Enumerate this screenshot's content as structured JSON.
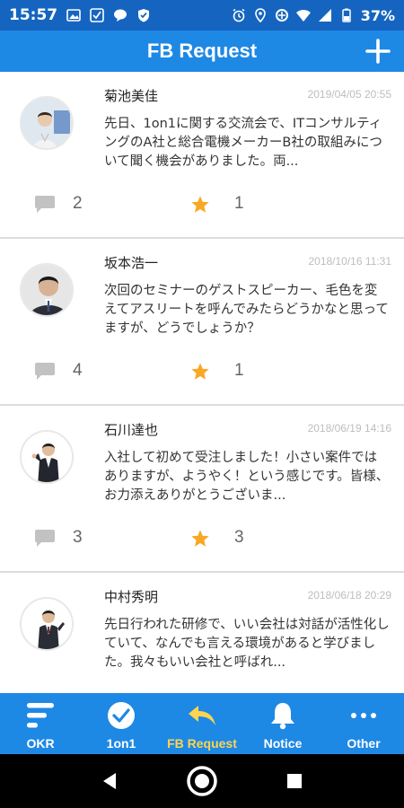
{
  "status_bar": {
    "time": "15:57",
    "battery": "37%"
  },
  "app_bar": {
    "title": "FB Request"
  },
  "colors": {
    "primary": "#1e88e5",
    "status": "#1565c0",
    "star": "#f9a825",
    "active_tab": "#ffd54f"
  },
  "feed": {
    "items": [
      {
        "name": "菊池美佳",
        "date": "2019/04/05 20:55",
        "text": "先日、1on1に関する交流会で、ITコンサルティングのA社と総合電機メーカーB社の取組みについて聞く機会がありました。両...",
        "comments": "2",
        "stars": "1"
      },
      {
        "name": "坂本浩一",
        "date": "2018/10/16 11:31",
        "text": "次回のセミナーのゲストスピーカー、毛色を変えてアスリートを呼んでみたらどうかなと思ってますが、どうでしょうか？",
        "comments": "4",
        "stars": "1"
      },
      {
        "name": "石川達也",
        "date": "2018/06/19 14:16",
        "text": "入社して初めて受注しました！小さい案件ではありますが、ようやく！という感じです。皆様、お力添えありがとうございま...",
        "comments": "3",
        "stars": "3"
      },
      {
        "name": "中村秀明",
        "date": "2018/06/18 20:29",
        "text": "先日行われた研修で、いい会社は対話が活性化していて、なんでも言える環境があると学びました。我々もいい会社と呼ばれ...",
        "comments": "",
        "stars": ""
      }
    ]
  },
  "tabs": [
    {
      "label": "OKR",
      "icon": "okr-bars-icon"
    },
    {
      "label": "1on1",
      "icon": "check-circle-icon"
    },
    {
      "label": "FB Request",
      "icon": "reply-arrow-icon",
      "active": true
    },
    {
      "label": "Notice",
      "icon": "bell-icon"
    },
    {
      "label": "Other",
      "icon": "more-dots-icon"
    }
  ]
}
